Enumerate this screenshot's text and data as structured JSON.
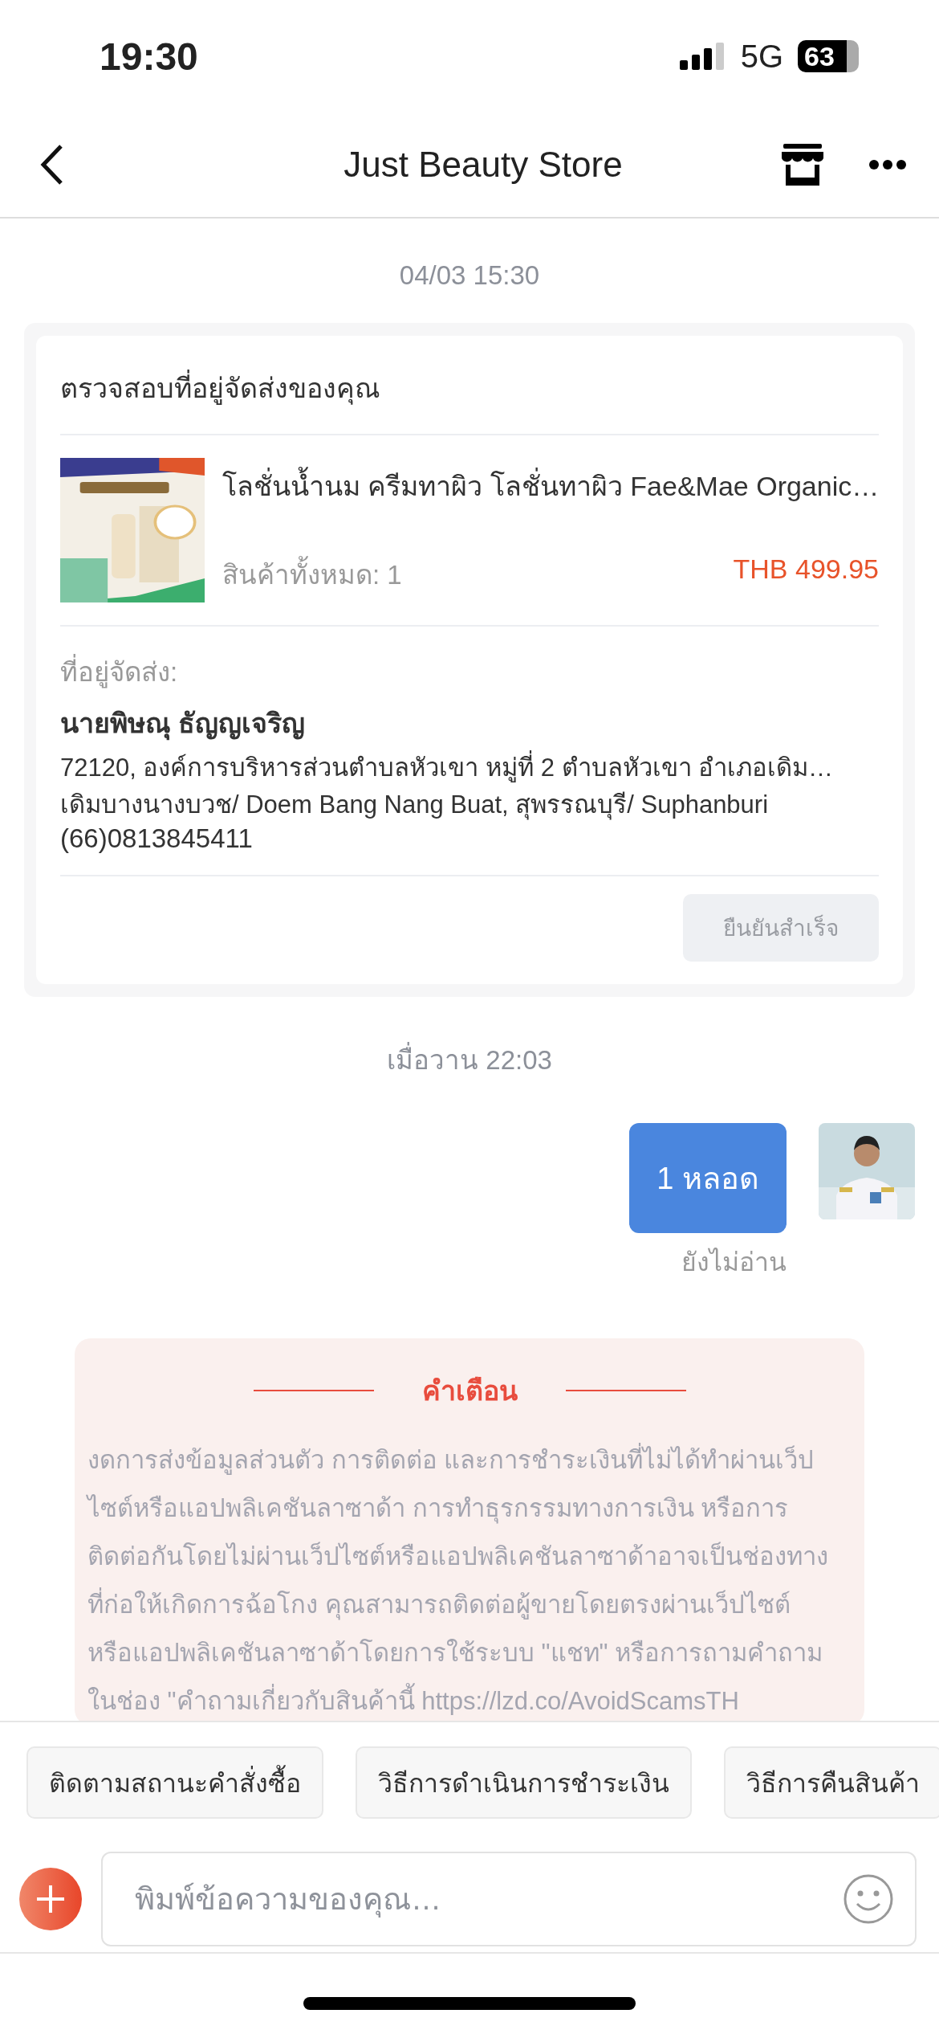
{
  "status_bar": {
    "time": "19:30",
    "network": "5G",
    "battery": "63"
  },
  "header": {
    "title": "Just Beauty Store"
  },
  "messages": [
    {
      "kind": "timestamp",
      "text": "04/03 15:30"
    },
    {
      "kind": "address_card",
      "title": "ตรวจสอบที่อยู่จัดส่งของคุณ",
      "product": {
        "name": "โลชั่นน้ำนม  ครีมทาผิว โลชั่นทาผิว Fae&Mae Organic…",
        "quantity": "สินค้าทั้งหมด: 1",
        "price": "THB 499.95"
      },
      "address_label": "ที่อยู่จัดส่ง:",
      "recipient": "นายพิษณุ ธัญญเจริญ",
      "address_lines": [
        "72120, องค์การบริหารส่วนตำบลหัวเขา หมู่ที่ 2 ตำบลหัวเขา อำเภอเดิม…",
        "เดิมบางนางบวช/ Doem Bang Nang Buat, สุพรรณบุรี/ Suphanburi"
      ],
      "phone": "(66)0813845411",
      "button": {
        "label": "ยืนยันสำเร็จ",
        "disabled": true
      }
    },
    {
      "kind": "timestamp",
      "text": "เมื่อวาน 22:03"
    },
    {
      "kind": "outgoing",
      "text": "1 หลอด",
      "status": "ยังไม่อ่าน"
    },
    {
      "kind": "warning",
      "title": "คำเตือน",
      "lines": [
        "งดการส่งข้อมูลส่วนตัว การติดต่อ และการชำระเงินที่ไม่ได้ทำผ่านเว็ป",
        "ไซต์หรือแอปพลิเคชันลาซาด้า การทำธุรกรรมทางการเงิน หรือการ",
        "ติดต่อกันโดยไม่ผ่านเว็ปไซต์หรือแอปพลิเคชันลาซาด้าอาจเป็นช่องทาง",
        "ที่ก่อให้เกิดการฉ้อโกง คุณสามารถติดต่อผู้ขายโดยตรงผ่านเว็ปไซต์",
        "หรือแอปพลิเคชันลาซาด้าโดยการใช้ระบบ \"แชท\" หรือการถามคำถาม",
        "ในช่อง \"คำถามเกี่ยวกับสินค้านี้ https://lzd.co/AvoidScamsTH"
      ]
    }
  ],
  "quick_replies": [
    "ติดตามสถานะคำสั่งซื้อ",
    "วิธีการดำเนินการชำระเงิน",
    "วิธีการคืนสินค้า"
  ],
  "composer": {
    "placeholder": "พิมพ์ข้อความของคุณ…"
  }
}
